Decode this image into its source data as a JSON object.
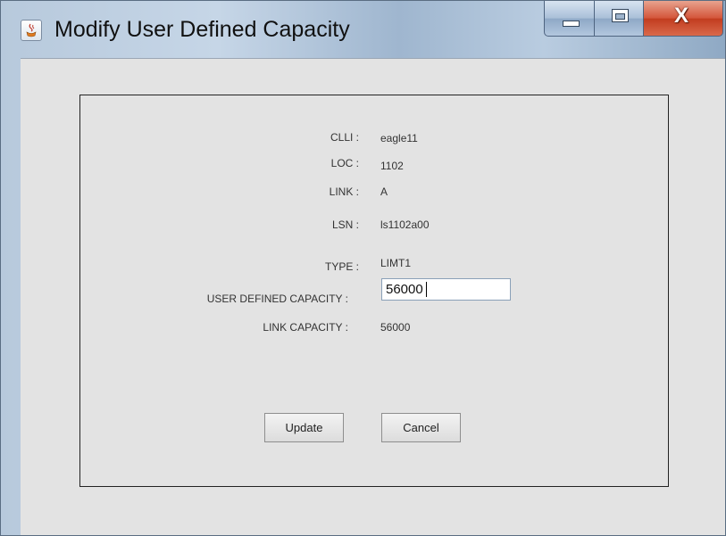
{
  "window": {
    "title": "Modify User Defined Capacity",
    "close_symbol": "X"
  },
  "fields": [
    {
      "label": "CLLI :",
      "value": "eagle11"
    },
    {
      "label": "LOC :",
      "value": "1102"
    },
    {
      "label": "LINK :",
      "value": "A"
    },
    {
      "label": "LSN :",
      "value": "ls1102a00"
    },
    {
      "label": "TYPE :",
      "value": "LIMT1"
    }
  ],
  "capacity": {
    "label": "USER DEFINED CAPACITY :",
    "input_value": "56000"
  },
  "link_capacity": {
    "label": "LINK CAPACITY :",
    "value": "56000"
  },
  "buttons": {
    "update": "Update",
    "cancel": "Cancel"
  }
}
